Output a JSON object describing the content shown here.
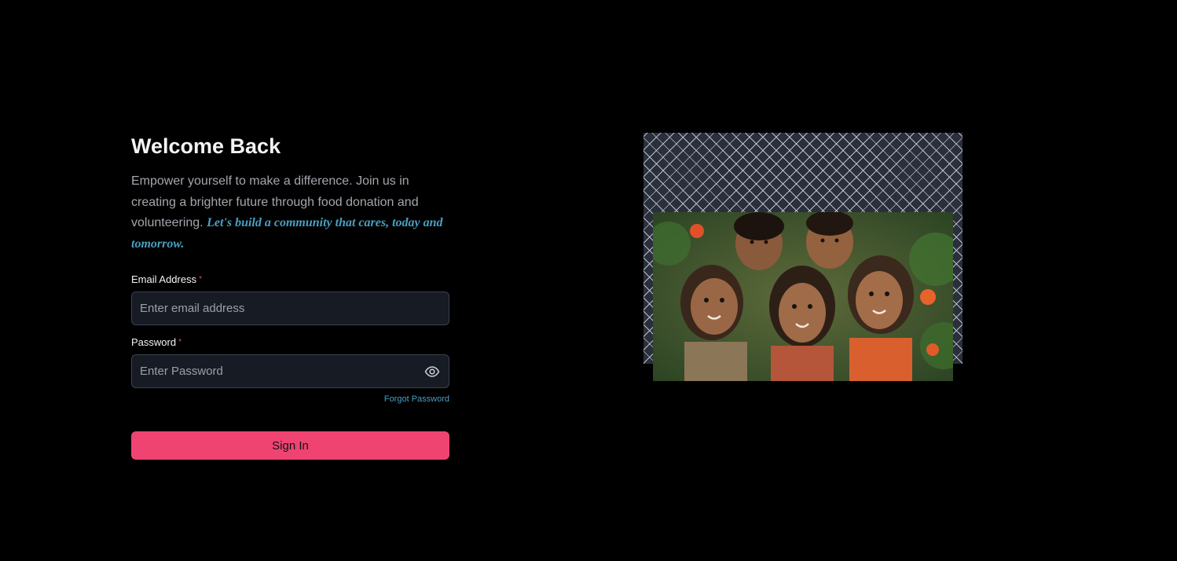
{
  "login": {
    "title": "Welcome Back",
    "intro_text": "Empower yourself to make a difference. Join us in creating a brighter future through food donation and volunteering.",
    "tagline": "Let's build a community that cares, today and tomorrow.",
    "email": {
      "label": "Email Address",
      "required_mark": "*",
      "placeholder": "Enter email address",
      "value": ""
    },
    "password": {
      "label": "Password",
      "required_mark": "*",
      "placeholder": "Enter Password",
      "value": "",
      "toggle_icon": "eye-icon"
    },
    "forgot_password_label": "Forgot Password",
    "sign_in_label": "Sign In"
  },
  "illustration": {
    "description_icon": "children-photo",
    "pattern": "diamond-mesh"
  },
  "colors": {
    "background": "#000000",
    "accent_pink": "#ef4472",
    "link_blue": "#4a9fc2",
    "input_bg": "#171b24",
    "input_border": "#3a4150"
  }
}
